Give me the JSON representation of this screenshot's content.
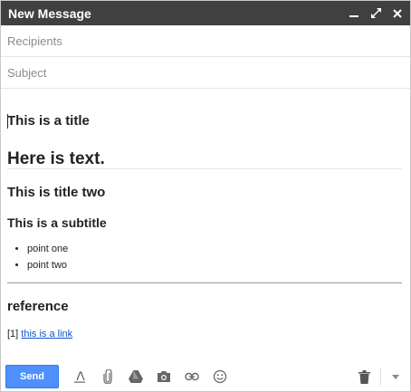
{
  "window": {
    "title": "New Message"
  },
  "fields": {
    "recipients_placeholder": "Recipients",
    "subject_placeholder": "Subject"
  },
  "body": {
    "title": "This is a title",
    "text": "Here is text.",
    "title_two": "This is title two",
    "subtitle": "This is a subtitle",
    "points": [
      "point one",
      "point two"
    ],
    "reference_heading": "reference",
    "reference_index": "[1]",
    "reference_link": "this is a link"
  },
  "toolbar": {
    "send_label": "Send"
  },
  "colors": {
    "titlebar": "#404040",
    "send": "#4d90fe",
    "link": "#1155cc"
  },
  "icons": [
    "minimize-icon",
    "expand-icon",
    "close-icon",
    "formatting-icon",
    "attach-icon",
    "drive-icon",
    "photo-icon",
    "link-icon",
    "emoji-icon",
    "trash-icon",
    "more-options-icon"
  ]
}
